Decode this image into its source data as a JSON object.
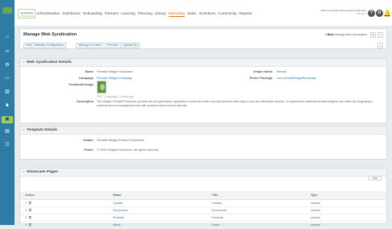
{
  "sidebar": {
    "icons": [
      "logo-icon",
      "home-icon",
      "binoculars-icon",
      "settings-icon",
      "document-icon",
      "chart-icon",
      "users-icon",
      "gift-icon",
      "window-icon",
      "sidebar-icon"
    ]
  },
  "topbar": {
    "brand_text": "emarketing",
    "nav": [
      "Administration",
      "Dashboard",
      "Onboarding",
      "Partners",
      "Learning",
      "Planning",
      "Library",
      "Marketing",
      "Sales",
      "Incentives",
      "Community",
      "Reports"
    ],
    "active_nav": "Marketing",
    "user_name": "Welcome Global Offline Channel Manager",
    "user_role": "Manager",
    "help_label": "?",
    "user_label": "o"
  },
  "header": {
    "title": "Manage Web Syndication",
    "buttons": [
      "Edit",
      "Visibility Configuration",
      "Manage Content",
      "Preview",
      "Upload Zip"
    ],
    "back_label": "« Back",
    "back_path": "Manage Web Syndication",
    "pin_label": "✎",
    "expand_label": "□",
    "next_label": ">"
  },
  "details": {
    "title": "Web Syndication Details",
    "name_label": "Name",
    "name_value": "Firewall Widget Showcase",
    "campaign_label": "Campaign",
    "campaign_value": "Firewall Widget Campaign",
    "unique_name_label": "Unique Name",
    "unique_name_value": "firewall",
    "zip_label": "Enrich Package",
    "zip_value": "com.firewallWidgetShowcase",
    "thumbnail_label": "Thumbnail Image",
    "thumbnail_caption": "PRC Campaign Thumb.jpg",
    "description_label": "Description",
    "description_value": "The Widget Firewall Protection provides all next generation application control and other security functions that easy-to-use and affordable solution. It outperforms traditional firewall widgets and offers by integrating a powerful secure management tool with scalable cloud content security."
  },
  "template": {
    "title": "Template Details",
    "header_label": "Header",
    "header_value": "Firewall Widget Product Showcase",
    "footer_label": "Footer",
    "footer_value": "© 2020 Widgets Networks. All rights reserved."
  },
  "showcase": {
    "title": "Showcase Pages",
    "add_label": "Add",
    "columns": [
      "Action",
      "Name",
      "Title",
      "Type"
    ],
    "rows": [
      {
        "name": "Contact",
        "title": "Contact",
        "type": "content"
      },
      {
        "name": "Documents",
        "title": "Documents",
        "type": "content"
      },
      {
        "name": "Products",
        "title": "Products",
        "type": "content"
      },
      {
        "name": "Home",
        "title": "Home",
        "type": "content"
      }
    ]
  },
  "colors": {
    "sidebar": "#2e7ba6",
    "active_nav": "#e0751b",
    "action_icons": "#d24b3f"
  }
}
